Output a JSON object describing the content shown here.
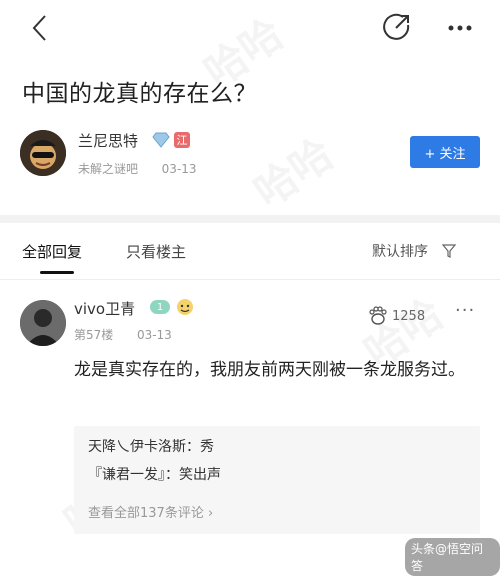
{
  "header": {
    "back_icon": "chevron-left-icon",
    "share_icon": "share-icon",
    "more_icon": "more-dots-icon"
  },
  "question": {
    "title": "中国的龙真的存在么？"
  },
  "author": {
    "name": "兰尼思特",
    "source": "未解之谜吧",
    "date": "03-13",
    "badge_text": "江",
    "follow_label": "+ 关注"
  },
  "tabs": {
    "all": "全部回复",
    "op_only": "只看楼主",
    "sort": "默认排序"
  },
  "reply": {
    "name": "vivo卫青",
    "level": "1",
    "floor": "第57楼",
    "date": "03-13",
    "likes": "1258",
    "more": "···",
    "text": "龙是真实存在的，我朋友前两天刚被一条龙服务过。",
    "comments": [
      {
        "author": "天降乀伊卡洛斯",
        "content": "秀"
      },
      {
        "author": "『谦君一发』",
        "content": "笑出声"
      }
    ],
    "view_all": "查看全部137条评论"
  },
  "watermark": {
    "tag": "头条@悟空问答"
  },
  "colors": {
    "accent": "#2e7be5",
    "separator": "#f2f2f2"
  }
}
